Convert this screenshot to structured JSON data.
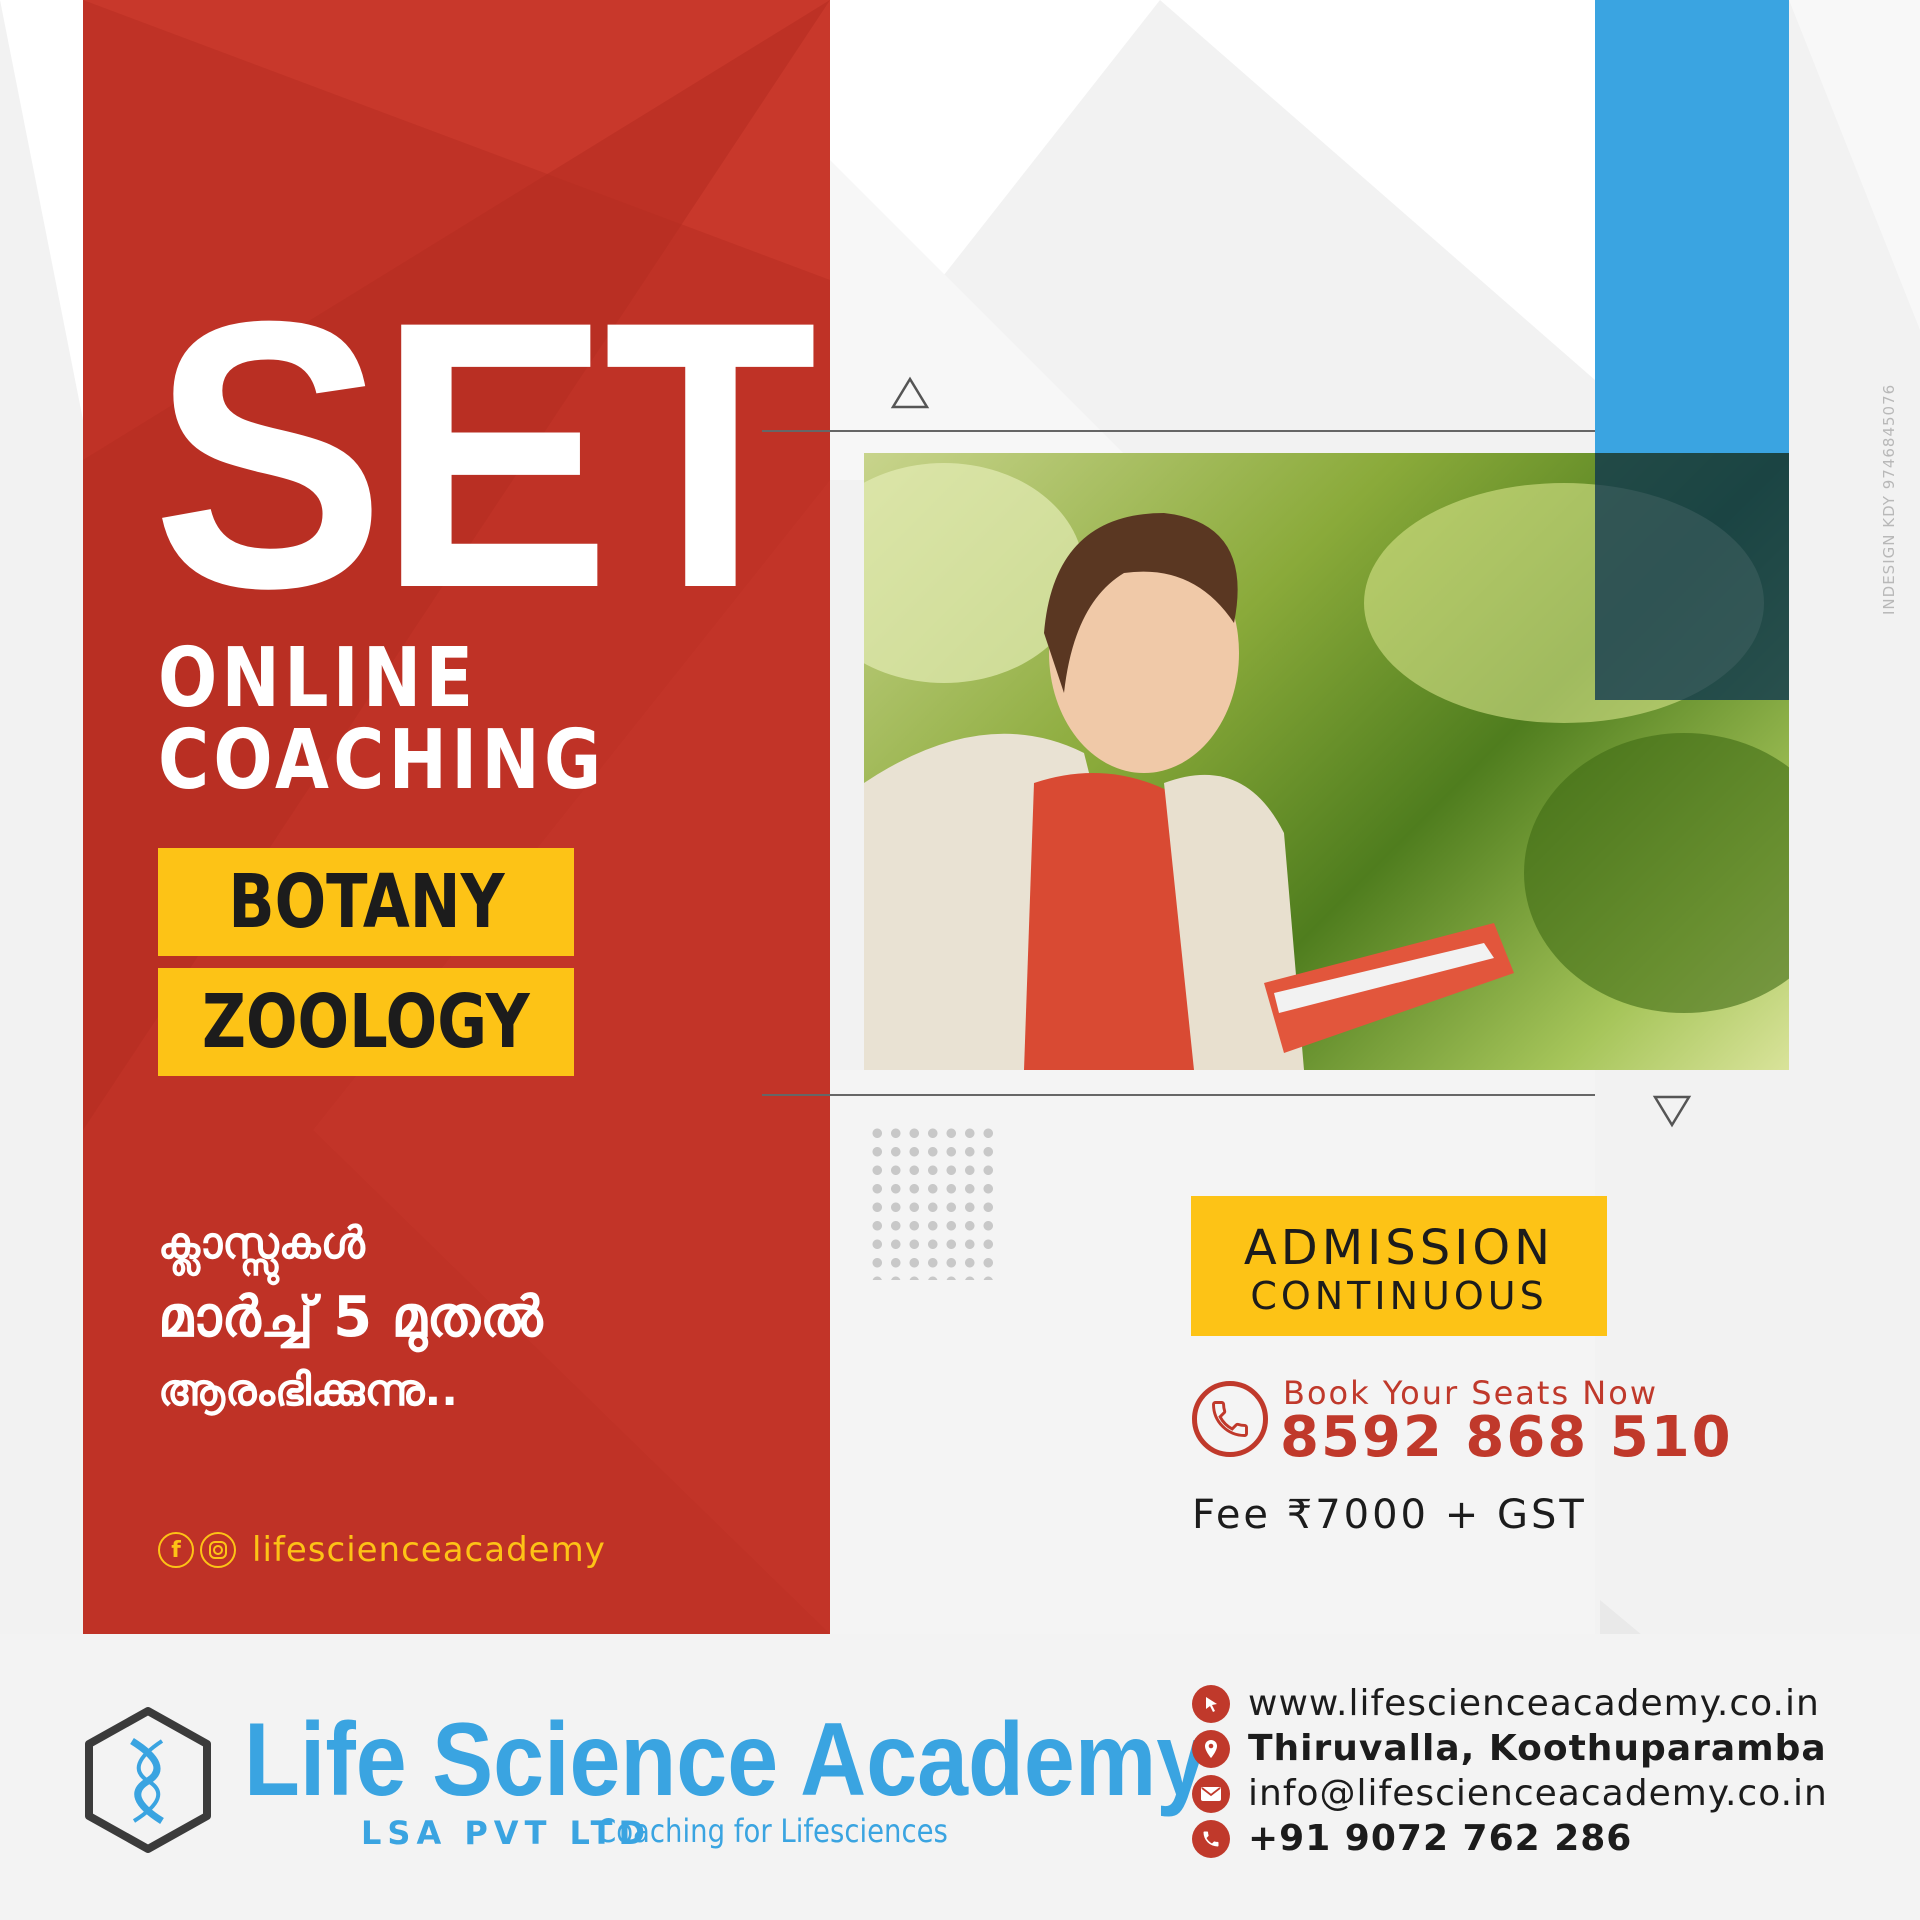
{
  "hero": {
    "title": "SET",
    "subtitle_line1": "ONLINE",
    "subtitle_line2": "COACHING",
    "subjects": [
      "BOTANY",
      "ZOOLOGY"
    ]
  },
  "announcement": {
    "line1": "ക്ലാസ്സുകൾ",
    "line2": "മാർച്ച് 5 മുതൽ",
    "line3": "ആരംഭിക്കുന്നു.."
  },
  "social": {
    "handle": "lifescienceacademy",
    "icons": [
      "facebook-icon",
      "instagram-icon"
    ]
  },
  "admission": {
    "line1": "ADMISSION",
    "line2": "CONTINUOUS"
  },
  "booking": {
    "label": "Book Your Seats Now",
    "number": "8592 868 510",
    "icon": "phone-icon"
  },
  "fee": "Fee ₹7000 + GST",
  "brand": {
    "name": "Life Science Academy",
    "company": "LSA PVT LTD",
    "tagline": "Coaching for Lifesciences",
    "logo_icon": "dna-hexagon-icon"
  },
  "contact": {
    "website": "www.lifescienceacademy.co.in",
    "locations": "Thiruvalla, Koothuparamba",
    "email": "info@lifescienceacademy.co.in",
    "phone": "+91 9072 762 286"
  },
  "watermark": "INDESIGN KDY 9746845076",
  "colors": {
    "red": "#bf3226",
    "yellow": "#fdc316",
    "blue": "#3aa4e1",
    "text_dark": "#1c1c1c"
  }
}
